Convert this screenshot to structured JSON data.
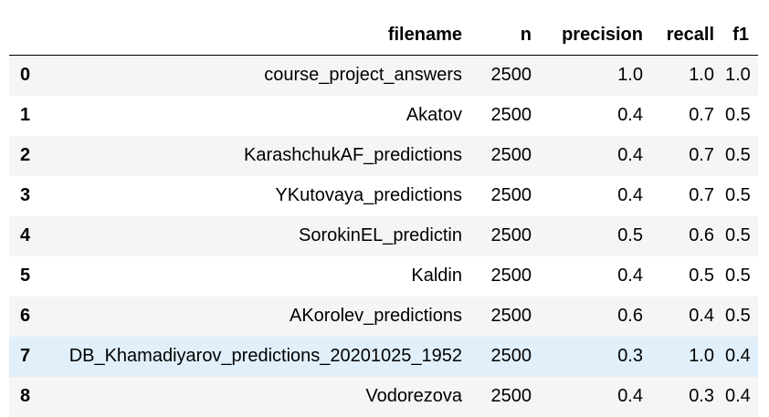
{
  "table": {
    "columns": {
      "index": "",
      "filename": "filename",
      "n": "n",
      "precision": "precision",
      "recall": "recall",
      "f1": "f1"
    },
    "rows": [
      {
        "index": "0",
        "filename": "course_project_answers",
        "n": "2500",
        "precision": "1.0",
        "recall": "1.0",
        "f1": "1.0"
      },
      {
        "index": "1",
        "filename": "Akatov",
        "n": "2500",
        "precision": "0.4",
        "recall": "0.7",
        "f1": "0.5"
      },
      {
        "index": "2",
        "filename": "KarashchukAF_predictions",
        "n": "2500",
        "precision": "0.4",
        "recall": "0.7",
        "f1": "0.5"
      },
      {
        "index": "3",
        "filename": "YKutovaya_predictions",
        "n": "2500",
        "precision": "0.4",
        "recall": "0.7",
        "f1": "0.5"
      },
      {
        "index": "4",
        "filename": "SorokinEL_predictin",
        "n": "2500",
        "precision": "0.5",
        "recall": "0.6",
        "f1": "0.5"
      },
      {
        "index": "5",
        "filename": "Kaldin",
        "n": "2500",
        "precision": "0.4",
        "recall": "0.5",
        "f1": "0.5"
      },
      {
        "index": "6",
        "filename": "AKorolev_predictions",
        "n": "2500",
        "precision": "0.6",
        "recall": "0.4",
        "f1": "0.5"
      },
      {
        "index": "7",
        "filename": "DB_Khamadiyarov_predictions_20201025_1952",
        "n": "2500",
        "precision": "0.3",
        "recall": "1.0",
        "f1": "0.4"
      },
      {
        "index": "8",
        "filename": "Vodorezova",
        "n": "2500",
        "precision": "0.4",
        "recall": "0.3",
        "f1": "0.4"
      }
    ]
  },
  "colors": {
    "odd_row": "#f5f5f5",
    "even_row": "#ffffff",
    "hover_row": "#e1effa",
    "header_rule": "#000000"
  },
  "hovered_row_index": 7
}
